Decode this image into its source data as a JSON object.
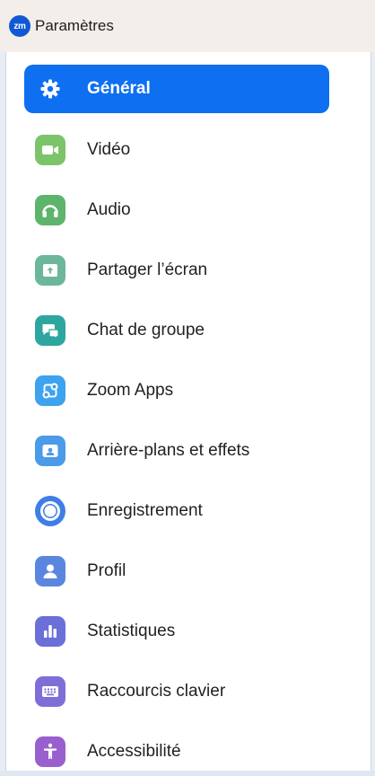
{
  "window": {
    "logo_text": "zm",
    "title": "Paramètres"
  },
  "sidebar": {
    "active": "general",
    "items": [
      {
        "id": "general",
        "label": "Général",
        "icon": "gear-icon"
      },
      {
        "id": "video",
        "label": "Vidéo",
        "icon": "video-camera-icon",
        "color": "#7cc46a"
      },
      {
        "id": "audio",
        "label": "Audio",
        "icon": "headphones-icon",
        "color": "#5db56c"
      },
      {
        "id": "share-screen",
        "label": "Partager l’écran",
        "icon": "share-screen-icon",
        "color": "#6cb79a"
      },
      {
        "id": "group-chat",
        "label": "Chat de groupe",
        "icon": "chat-icon",
        "color": "#2ea6a0"
      },
      {
        "id": "zoom-apps",
        "label": "Zoom Apps",
        "icon": "apps-icon",
        "color": "#3da3ee"
      },
      {
        "id": "backgrounds",
        "label": "Arrière-plans et effets",
        "icon": "background-icon",
        "color": "#4b9be8"
      },
      {
        "id": "recording",
        "label": "Enregistrement",
        "icon": "record-icon",
        "color": "#3e7ee6"
      },
      {
        "id": "profile",
        "label": "Profil",
        "icon": "profile-icon",
        "color": "#5b86df"
      },
      {
        "id": "statistics",
        "label": "Statistiques",
        "icon": "statistics-icon",
        "color": "#6b6fd8"
      },
      {
        "id": "keyboard-shortcuts",
        "label": "Raccourcis clavier",
        "icon": "keyboard-icon",
        "color": "#7e6fd8"
      },
      {
        "id": "accessibility",
        "label": "Accessibilité",
        "icon": "accessibility-icon",
        "color": "#9a5fcf"
      }
    ]
  }
}
